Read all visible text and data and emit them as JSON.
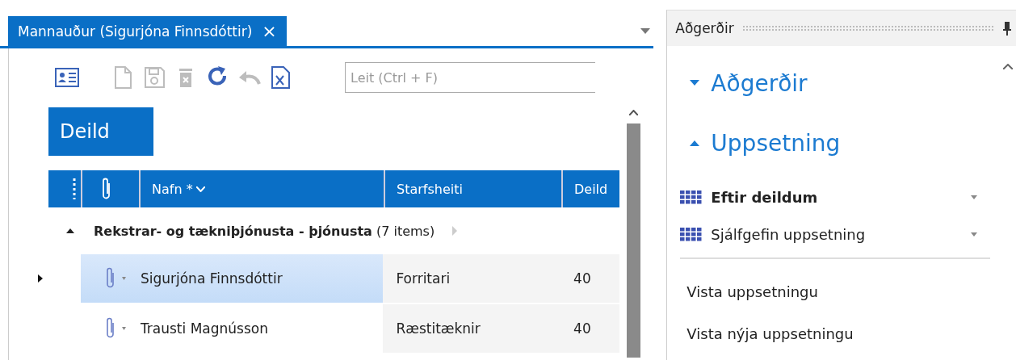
{
  "document_tab": {
    "title": "Mannauður (Sigurjóna Finnsdóttir)",
    "close": "×"
  },
  "toolbar": [
    {
      "kind": "card",
      "disabled": false
    },
    {
      "kind": "new",
      "disabled": true
    },
    {
      "kind": "save",
      "disabled": true
    },
    {
      "kind": "delete",
      "disabled": true
    },
    {
      "kind": "refresh",
      "disabled": false
    },
    {
      "kind": "undo",
      "disabled": true
    },
    {
      "kind": "excel",
      "disabled": false
    }
  ],
  "search": {
    "placeholder": "Leit (Ctrl + F)"
  },
  "group_by_chip": "Deild",
  "table": {
    "columns": [
      "Nafn * ",
      "Starfsheiti",
      "Deild"
    ],
    "group": {
      "name": "Rekstrar- og tækniþjónusta - þjónusta",
      "count": "(7 items)",
      "expanded": true
    },
    "rows": [
      {
        "name": "Sigurjóna Finnsdóttir",
        "job_title": "Forritari",
        "department": "40",
        "selected": true,
        "current": true
      },
      {
        "name": "Trausti Magnússon",
        "job_title": "Ræstitæknir",
        "department": "40",
        "selected": false,
        "current": false
      }
    ]
  },
  "actions_panel": {
    "title": "Aðgerðir",
    "sections": [
      {
        "title": "Aðgerðir",
        "expanded": false
      },
      {
        "title": "Uppsetning",
        "expanded": true
      }
    ],
    "layouts": [
      {
        "label": "Eftir deildum",
        "active": true
      },
      {
        "label": "Sjálfgefin uppsetning",
        "active": false
      }
    ],
    "links": [
      "Vista uppsetningu",
      "Vista nýja uppsetningu"
    ]
  }
}
